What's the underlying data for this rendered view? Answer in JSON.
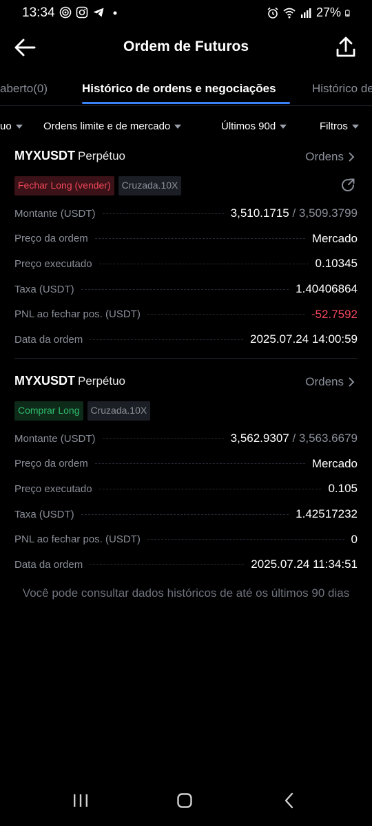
{
  "status_bar": {
    "time": "13:34",
    "battery": "27%"
  },
  "header": {
    "title": "Ordem de Futuros"
  },
  "tabs": [
    {
      "label": "aberto(0)"
    },
    {
      "label": "Histórico de ordens e negociações"
    },
    {
      "label": "Histórico de"
    }
  ],
  "filters": [
    {
      "label": "uo"
    },
    {
      "label": "Ordens limite e de mercado"
    },
    {
      "label": "Últimos 90d"
    },
    {
      "label": "Filtros"
    }
  ],
  "orders": [
    {
      "symbol": "MYXUSDT",
      "contract": "Perpétuo",
      "link": "Ordens",
      "side": "Fechar Long (vender)",
      "margin": "Cruzada.10X",
      "rows": {
        "amount_label": "Montante (USDT)",
        "amount": "3,510.1715",
        "amount_sep": " / ",
        "amount_total": "3,509.3799",
        "price_label": "Preço da ordem",
        "price": "Mercado",
        "exec_label": "Preço executado",
        "exec": "0.10345",
        "fee_label": "Taxa (USDT)",
        "fee": "1.40406864",
        "pnl_label": "PNL ao fechar pos. (USDT)",
        "pnl": "-52.7592",
        "date_label": "Data da ordem",
        "date": "2025.07.24 14:00:59"
      }
    },
    {
      "symbol": "MYXUSDT",
      "contract": "Perpétuo",
      "link": "Ordens",
      "side": "Comprar Long",
      "margin": "Cruzada.10X",
      "rows": {
        "amount_label": "Montante (USDT)",
        "amount": "3,562.9307",
        "amount_sep": " / ",
        "amount_total": "3,563.6679",
        "price_label": "Preço da ordem",
        "price": "Mercado",
        "exec_label": "Preço executado",
        "exec": "0.105",
        "fee_label": "Taxa (USDT)",
        "fee": "1.42517232",
        "pnl_label": "PNL ao fechar pos. (USDT)",
        "pnl": "0",
        "date_label": "Data da ordem",
        "date": "2025.07.24 11:34:51"
      }
    }
  ],
  "footer_note": "Você pode consultar dados históricos de até os últimos 90 dias",
  "colors": {
    "accent": "#3b82f6",
    "sell": "#f0465a",
    "buy": "#2fbd6c",
    "muted": "#8a8f99",
    "background": "#000000"
  }
}
